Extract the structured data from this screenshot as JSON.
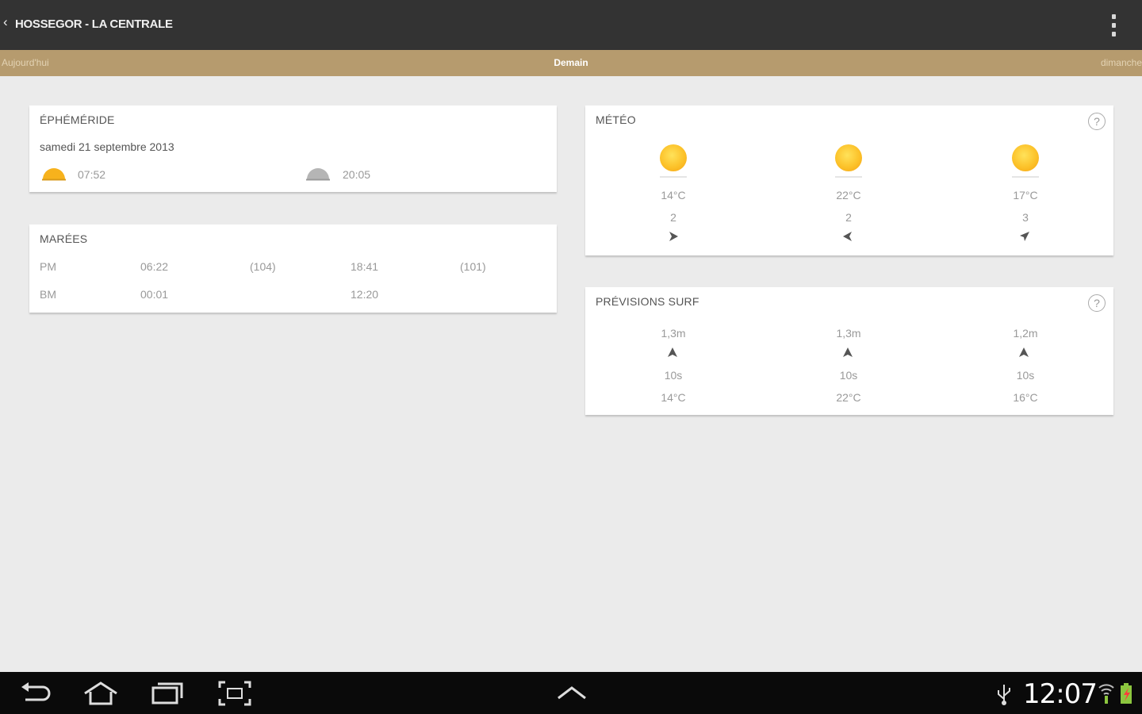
{
  "header": {
    "title": "HOSSEGOR - LA CENTRALE"
  },
  "tabs": [
    {
      "label": "Aujourd'hui",
      "active": false
    },
    {
      "label": "Demain",
      "active": true
    },
    {
      "label": "dimanche",
      "active": false
    }
  ],
  "ephemeride": {
    "title": "ÉPHÉMÉRIDE",
    "date": "samedi 21 septembre 2013",
    "sunrise": "07:52",
    "sunset": "20:05"
  },
  "marees": {
    "title": "MARÉES",
    "rows": [
      {
        "label": "PM",
        "t1": "06:22",
        "c1": "(104)",
        "t2": "18:41",
        "c2": "(101)"
      },
      {
        "label": "BM",
        "t1": "00:01",
        "c1": "",
        "t2": "12:20",
        "c2": ""
      }
    ]
  },
  "meteo": {
    "title": "MÉTÉO",
    "help": "?",
    "columns": [
      {
        "icon": "sun-icon",
        "temp": "14°C",
        "wind": "2",
        "wind_dir": "wind-east-arrow-icon"
      },
      {
        "icon": "sun-icon",
        "temp": "22°C",
        "wind": "2",
        "wind_dir": "wind-west-arrow-icon"
      },
      {
        "icon": "sun-icon",
        "temp": "17°C",
        "wind": "3",
        "wind_dir": "wind-southwest-arrow-icon"
      }
    ]
  },
  "surf": {
    "title": "PRÉVISIONS SURF",
    "help": "?",
    "columns": [
      {
        "height": "1,3m",
        "period": "10s",
        "temp": "14°C"
      },
      {
        "height": "1,3m",
        "period": "10s",
        "temp": "22°C"
      },
      {
        "height": "1,2m",
        "period": "10s",
        "temp": "16°C"
      }
    ]
  },
  "statusbar": {
    "time": "12:07"
  },
  "colors": {
    "actionbar": "#333333",
    "tabstrip": "#b69b6e",
    "background": "#ebebeb",
    "sun": "#fcc22a"
  }
}
